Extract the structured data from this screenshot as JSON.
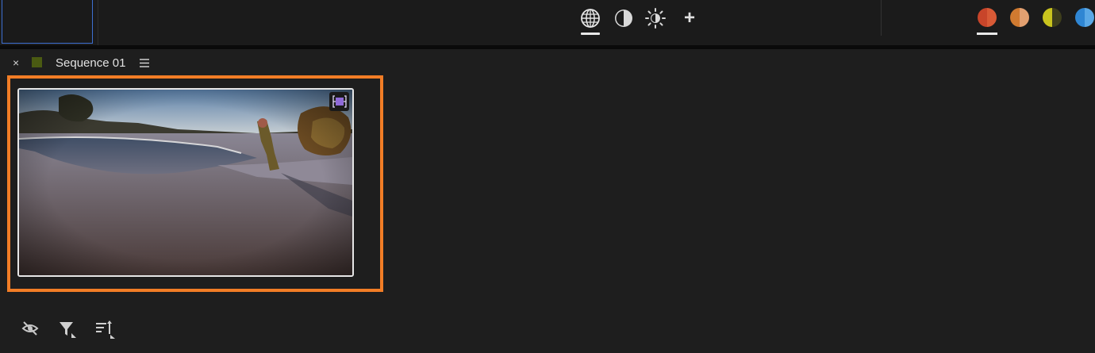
{
  "panel": {
    "title": "Sequence 01",
    "close_glyph": "×",
    "label_color": "#4a5a12"
  },
  "toolbar": {
    "modes": [
      {
        "name": "global-icon",
        "selected": true
      },
      {
        "name": "contrast-icon",
        "selected": false
      },
      {
        "name": "brightness-icon",
        "selected": false
      },
      {
        "name": "plus-icon",
        "selected": false
      }
    ],
    "add_glyph": "+"
  },
  "swatches": [
    {
      "name": "red-orange",
      "left": "#c8452a",
      "right": "#d85a36",
      "selected": true
    },
    {
      "name": "orange",
      "left": "#d07a30",
      "right": "#e3a070",
      "selected": false
    },
    {
      "name": "yellow",
      "left": "#c9c41e",
      "right": "#3e3e1c",
      "selected": false
    },
    {
      "name": "blue",
      "left": "#2f86d3",
      "right": "#5aa8e6",
      "selected": false
    }
  ],
  "clip": {
    "badge_icon": "sequence-badge-icon",
    "highlight_color": "#f27d26"
  },
  "footer": {
    "icons": [
      "hide-icon",
      "filter-icon",
      "sort-icon"
    ]
  }
}
